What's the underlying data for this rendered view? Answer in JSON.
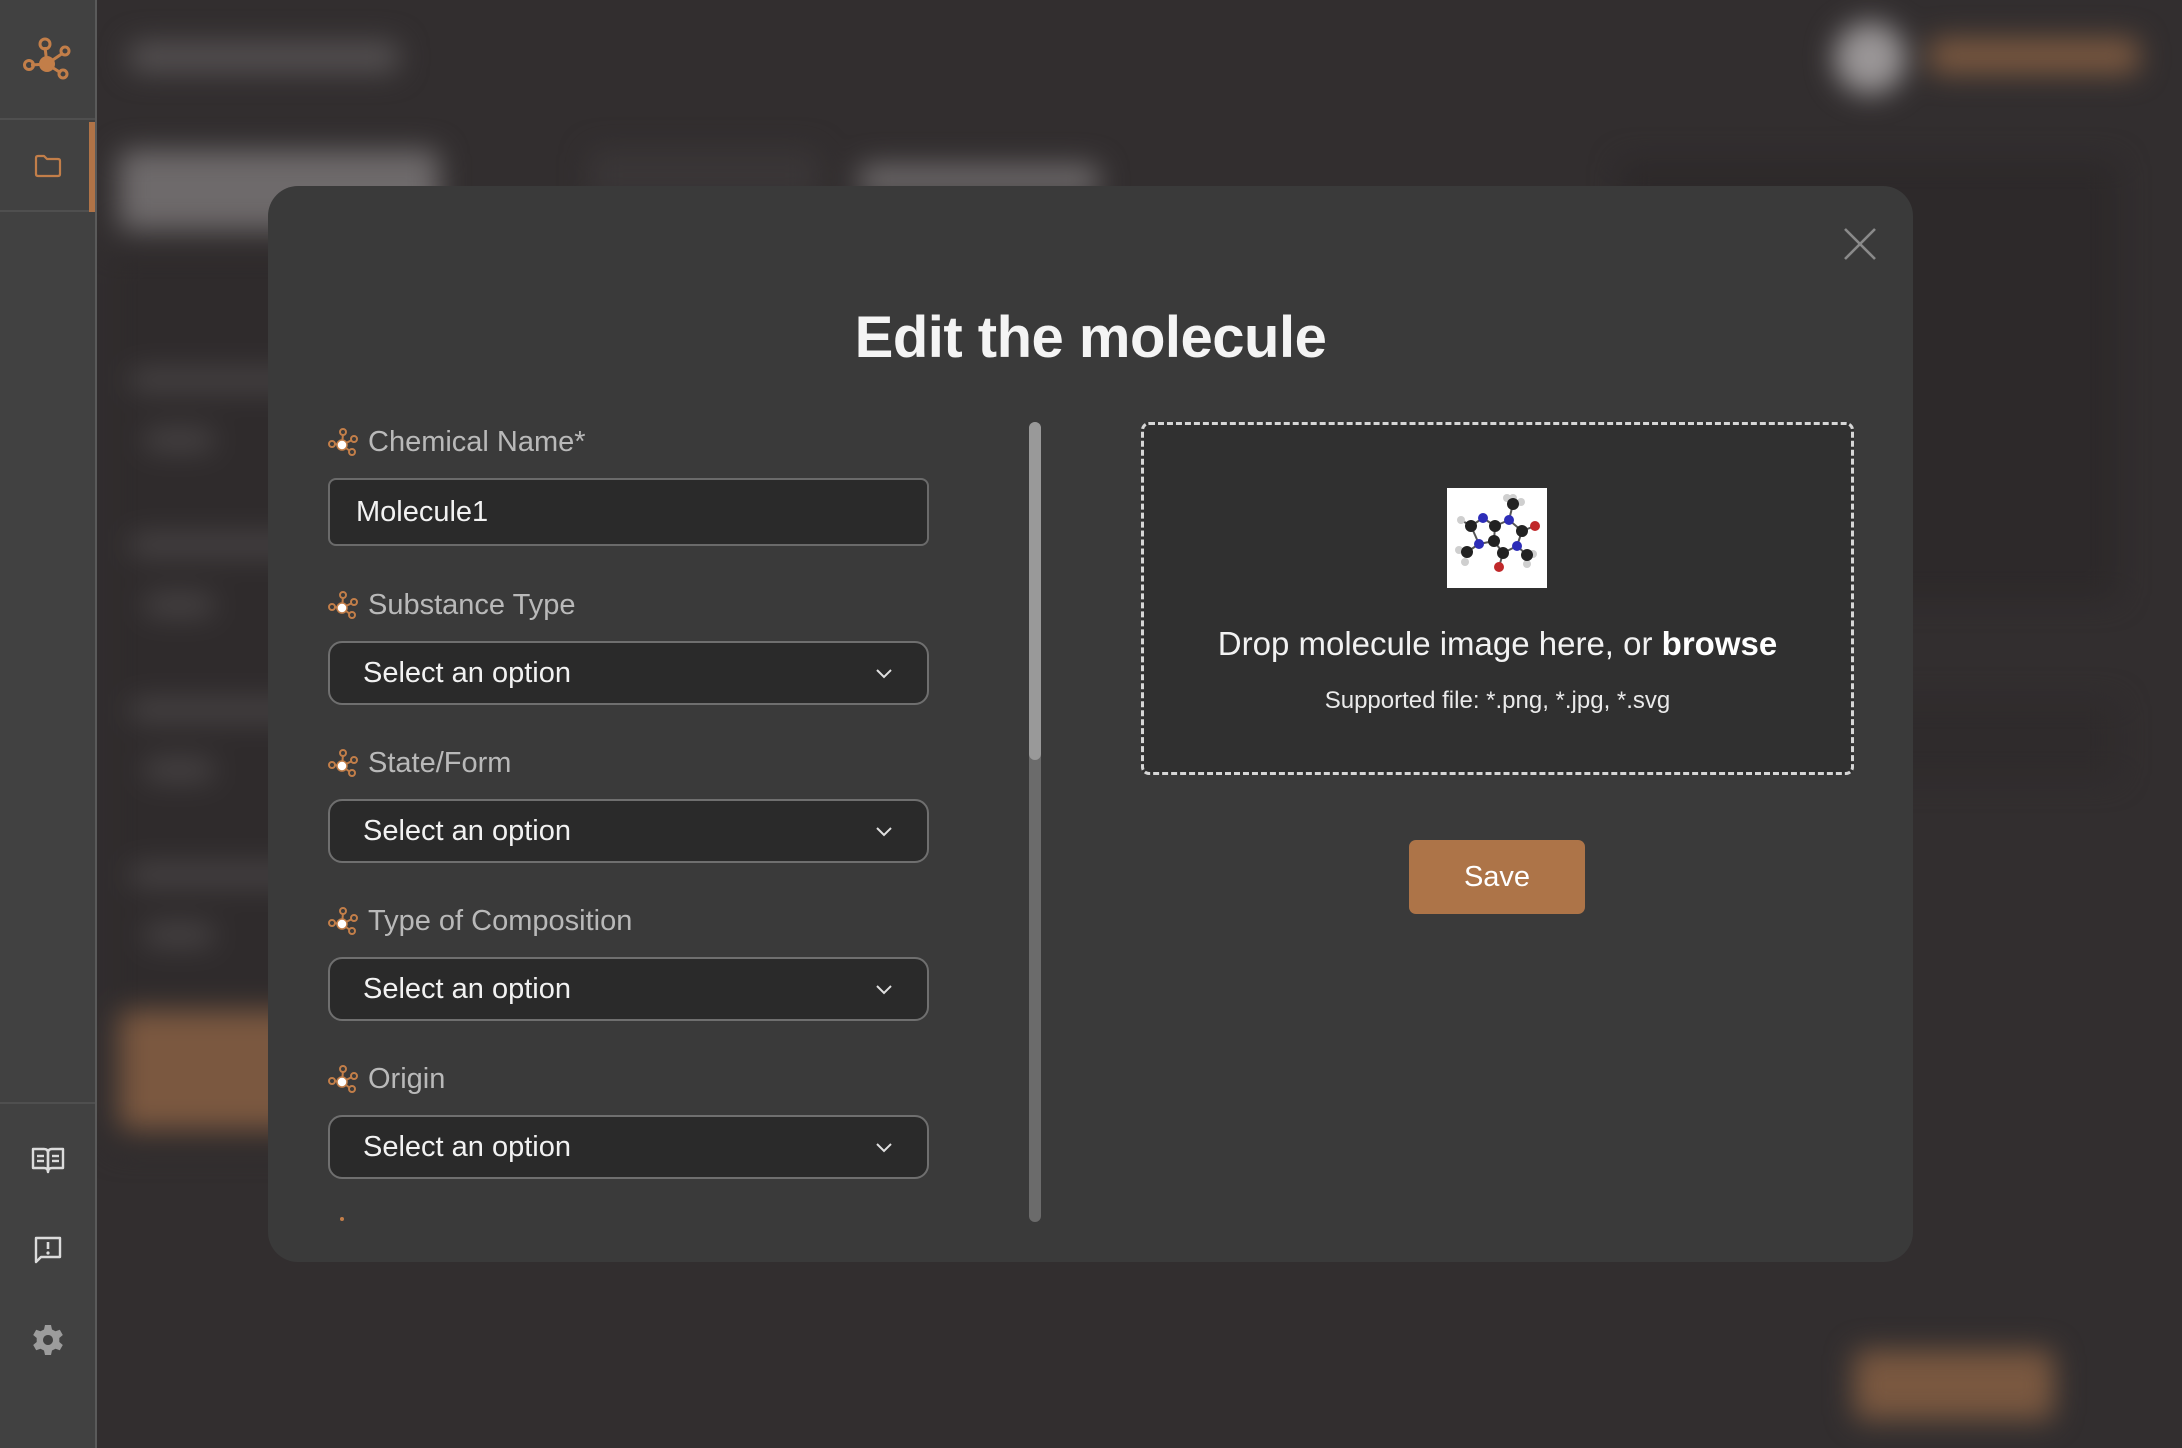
{
  "colors": {
    "accent": "#ad7448",
    "modal_bg": "#3a3a3a",
    "input_bg": "#2a2a2a",
    "sidebar_bg": "#414141",
    "page_bg": "#322e2f"
  },
  "sidebar": {
    "logo_icon": "molecule-logo-icon",
    "items": [
      {
        "name": "folder",
        "icon": "folder-icon",
        "active": true
      }
    ],
    "bottom_items": [
      {
        "name": "documentation",
        "icon": "book-open-icon"
      },
      {
        "name": "feedback",
        "icon": "feedback-icon"
      },
      {
        "name": "settings",
        "icon": "gear-icon"
      }
    ]
  },
  "modal": {
    "title": "Edit the molecule",
    "close_icon": "close-icon",
    "fields": [
      {
        "label": "Chemical Name*",
        "type": "text",
        "value": "Molecule1"
      },
      {
        "label": "Substance Type",
        "type": "select",
        "value": "Select an option"
      },
      {
        "label": "State/Form",
        "type": "select",
        "value": "Select an option"
      },
      {
        "label": "Type of Composition",
        "type": "select",
        "value": "Select an option"
      },
      {
        "label": "Origin",
        "type": "select",
        "value": "Select an option"
      }
    ],
    "dropzone": {
      "text": "Drop molecule image here, or ",
      "browse_label": "browse",
      "supported": "Supported file: *.png, *.jpg, *.svg",
      "preview_alt": "molecule preview"
    },
    "save_label": "Save"
  }
}
